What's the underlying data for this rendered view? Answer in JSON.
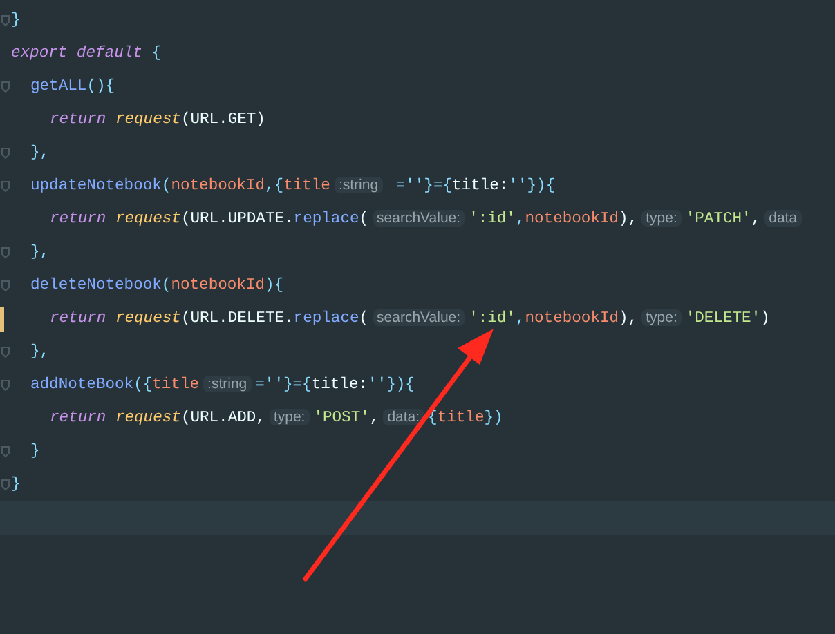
{
  "editor": {
    "lines": [
      {
        "fold": true,
        "modified": false,
        "tokens": [
          {
            "kind": "punct",
            "text": "}"
          }
        ]
      },
      {
        "fold": false,
        "modified": false,
        "tokens": [
          {
            "kind": "keyword",
            "text": "export default "
          },
          {
            "kind": "punct",
            "text": "{"
          }
        ],
        "children": [
          {
            "fold": true,
            "modified": false,
            "tokens": [
              {
                "kind": "method",
                "text": "getALL"
              },
              {
                "kind": "punct",
                "text": "(){"
              }
            ],
            "children": [
              {
                "fold": false,
                "modified": false,
                "tokens": [
                  {
                    "kind": "keyword",
                    "text": "return "
                  },
                  {
                    "kind": "function",
                    "text": "request"
                  },
                  {
                    "kind": "plain",
                    "text": "(URL.GET)"
                  }
                ]
              }
            ]
          },
          {
            "fold": true,
            "modified": false,
            "tokens": [
              {
                "kind": "punct",
                "text": "},"
              }
            ]
          },
          {
            "fold": true,
            "modified": false,
            "tokens": [
              {
                "kind": "method",
                "text": "updateNotebook"
              },
              {
                "kind": "punct",
                "text": "("
              },
              {
                "kind": "param",
                "text": "notebookId"
              },
              {
                "kind": "punct",
                "text": ",{"
              },
              {
                "kind": "param",
                "text": "title"
              },
              {
                "kind": "hint",
                "text": ":string"
              },
              {
                "kind": "punct",
                "text": " =''}={"
              },
              {
                "kind": "plain",
                "text": "title:"
              },
              {
                "kind": "punct",
                "text": "''}){"
              }
            ],
            "children": [
              {
                "fold": false,
                "modified": false,
                "tokens": [
                  {
                    "kind": "keyword",
                    "text": "return "
                  },
                  {
                    "kind": "function",
                    "text": "request"
                  },
                  {
                    "kind": "plain",
                    "text": "(URL.UPDATE."
                  },
                  {
                    "kind": "method",
                    "text": "replace"
                  },
                  {
                    "kind": "plain",
                    "text": "("
                  },
                  {
                    "kind": "hint",
                    "text": "searchValue:"
                  },
                  {
                    "kind": "string",
                    "text": "':id'"
                  },
                  {
                    "kind": "punct",
                    "text": ","
                  },
                  {
                    "kind": "param",
                    "text": "notebookId"
                  },
                  {
                    "kind": "plain",
                    "text": "),"
                  },
                  {
                    "kind": "hint",
                    "text": "type:"
                  },
                  {
                    "kind": "string",
                    "text": "'PATCH'"
                  },
                  {
                    "kind": "plain",
                    "text": ","
                  },
                  {
                    "kind": "hint",
                    "text": "data"
                  }
                ]
              }
            ]
          },
          {
            "fold": true,
            "modified": false,
            "tokens": [
              {
                "kind": "punct",
                "text": "},"
              }
            ]
          },
          {
            "fold": true,
            "modified": false,
            "tokens": [
              {
                "kind": "method",
                "text": "deleteNotebook"
              },
              {
                "kind": "punct",
                "text": "("
              },
              {
                "kind": "param",
                "text": "notebookId"
              },
              {
                "kind": "punct",
                "text": "){"
              }
            ],
            "children": [
              {
                "fold": false,
                "modified": true,
                "tokens": [
                  {
                    "kind": "keyword",
                    "text": "return "
                  },
                  {
                    "kind": "function",
                    "text": "request"
                  },
                  {
                    "kind": "plain",
                    "text": "(URL.DELETE."
                  },
                  {
                    "kind": "method",
                    "text": "replace"
                  },
                  {
                    "kind": "plain",
                    "text": "("
                  },
                  {
                    "kind": "hint",
                    "text": "searchValue:"
                  },
                  {
                    "kind": "string",
                    "text": "':id'"
                  },
                  {
                    "kind": "punct",
                    "text": ","
                  },
                  {
                    "kind": "param",
                    "text": "notebookId"
                  },
                  {
                    "kind": "plain",
                    "text": "),"
                  },
                  {
                    "kind": "hint",
                    "text": "type:"
                  },
                  {
                    "kind": "string",
                    "text": "'DELETE'"
                  },
                  {
                    "kind": "plain",
                    "text": ")"
                  }
                ]
              }
            ]
          },
          {
            "fold": true,
            "modified": false,
            "tokens": [
              {
                "kind": "punct",
                "text": "},"
              }
            ]
          },
          {
            "fold": true,
            "modified": false,
            "tokens": [
              {
                "kind": "method",
                "text": "addNoteBook"
              },
              {
                "kind": "punct",
                "text": "({"
              },
              {
                "kind": "param",
                "text": "title"
              },
              {
                "kind": "hint",
                "text": ":string"
              },
              {
                "kind": "punct",
                "text": "=''}={"
              },
              {
                "kind": "plain",
                "text": "title:"
              },
              {
                "kind": "punct",
                "text": "''}){"
              }
            ],
            "children": [
              {
                "fold": false,
                "modified": false,
                "tokens": [
                  {
                    "kind": "keyword",
                    "text": "return "
                  },
                  {
                    "kind": "function",
                    "text": "request"
                  },
                  {
                    "kind": "plain",
                    "text": "(URL.ADD,"
                  },
                  {
                    "kind": "hint",
                    "text": "type:"
                  },
                  {
                    "kind": "string",
                    "text": "'POST'"
                  },
                  {
                    "kind": "plain",
                    "text": ","
                  },
                  {
                    "kind": "hint",
                    "text": "data:"
                  },
                  {
                    "kind": "punct",
                    "text": "{"
                  },
                  {
                    "kind": "param",
                    "text": "title"
                  },
                  {
                    "kind": "punct",
                    "text": "})"
                  }
                ]
              }
            ]
          },
          {
            "fold": true,
            "modified": false,
            "tokens": [
              {
                "kind": "punct",
                "text": "}"
              }
            ]
          }
        ]
      },
      {
        "fold": true,
        "modified": false,
        "tokens": [
          {
            "kind": "punct",
            "text": "}"
          }
        ]
      }
    ]
  }
}
